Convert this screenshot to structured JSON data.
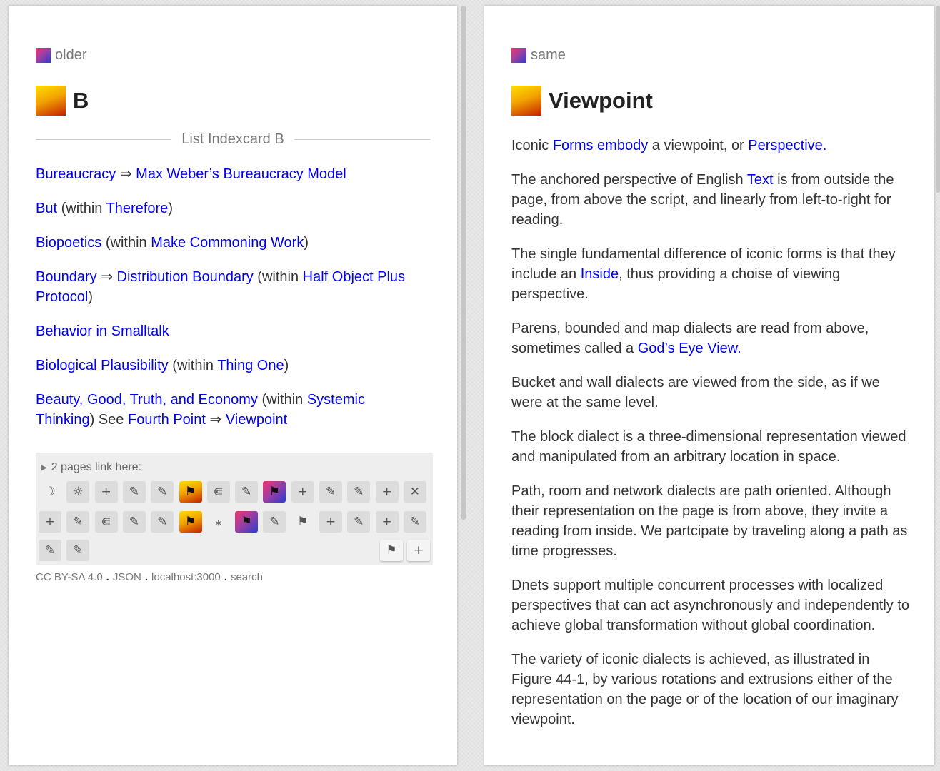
{
  "left": {
    "context_label": "older",
    "title": "B",
    "indexcard_label": "List Indexcard B",
    "entries": [
      {
        "a": "Bureaucracy",
        "arrow": "⇒",
        "b": "Max Weber’s Bureaucracy Model"
      },
      {
        "a": "But",
        "w1": "(within",
        "b": "Therefore",
        "w2": ")"
      },
      {
        "a": "Biopoetics",
        "w1": "(within",
        "b": "Make Commoning Work",
        "w2": ")"
      },
      {
        "a": "Boundary",
        "arrow": "⇒",
        "b": "Distribution Boundary",
        "w1": "(within",
        "c": "Half Object Plus Protocol",
        "w2": ")"
      },
      {
        "a": "Behavior in Smalltalk"
      },
      {
        "a": "Biological Plausibility",
        "w1": "(within",
        "b": "Thing One",
        "w2": ")"
      },
      {
        "a": "Beauty, Good, Truth, and Economy",
        "w1": "(within",
        "b": "Systemic Thinking",
        "w2": ") See",
        "c": "Fourth Point",
        "arrow": "⇒",
        "d": "Viewpoint"
      }
    ],
    "refs_summary": "2 pages link here:",
    "journal": {
      "row1": [
        "☽",
        "☼",
        "+",
        "✎",
        "✎",
        "⚑",
        "⋐",
        "✎",
        "⚑",
        "+",
        "✎",
        "✎",
        "+",
        "✕"
      ],
      "row2": [
        "+",
        "✎",
        "⋐",
        "✎",
        "✎",
        "⚑",
        "⁎",
        "⚑",
        "✎",
        "⚑",
        "+",
        "✎",
        "+",
        "✎"
      ],
      "row3": [
        "✎",
        "✎"
      ],
      "tools": [
        "⚑",
        "+"
      ]
    },
    "footer": {
      "license": "CC BY-SA 4.0",
      "json": "JSON",
      "host": "localhost:3000",
      "search": "search",
      "dot": "."
    }
  },
  "right": {
    "context_label": "same",
    "title": "Viewpoint",
    "p1": {
      "t1": "Iconic",
      "l1": "Forms",
      "l2": "embody",
      "t2": "a viewpoint, or",
      "l3": "Perspective."
    },
    "p2": {
      "t1": "The anchored perspective of English",
      "l1": "Text",
      "t2": "is from outside the page, from above the script, and linearly from left-to-right for reading."
    },
    "p3": {
      "t1": "The single fundamental difference of iconic forms is that they include an",
      "l1": "Inside",
      "t2": ", thus providing a choise of viewing perspective."
    },
    "p4": {
      "t1": "Parens, bounded and map dialects are read from above, sometimes called a",
      "l1": "God’s Eye View."
    },
    "p5": "Bucket and wall dialects are viewed from the side, as if we were at the same level.",
    "p6": "The block dialect is a three-dimensional representation viewed and manipulated from an arbitrary location in space.",
    "p7": "Path, room and network dialects are path oriented. Although their representation on the page is from above, they invite a reading from inside. We partcipate by traveling along a path as time progresses.",
    "p8": "Dnets support multiple concurrent processes with localized perspectives that can act asynchronously and independently to achieve global transformation without global coordination.",
    "p9": "The variety of iconic dialects is achieved, as illustrated in Figure 44-1, by various rotations and extrusions either of the representation on the page or of the location of our imaginary viewpoint."
  }
}
